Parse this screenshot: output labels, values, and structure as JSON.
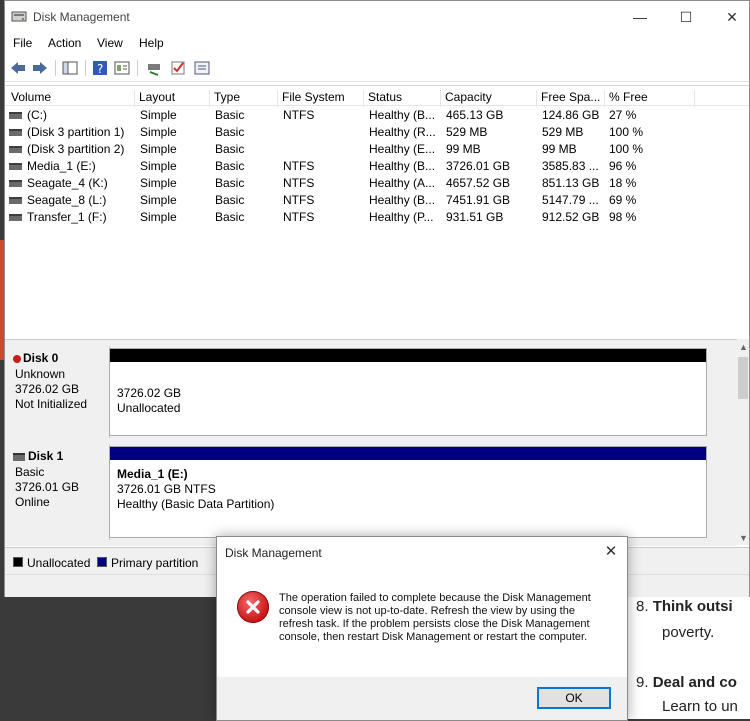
{
  "window": {
    "title": "Disk Management",
    "controls": {
      "minimize": "—",
      "maximize": "☐",
      "close": "✕"
    }
  },
  "menu": [
    "File",
    "Action",
    "View",
    "Help"
  ],
  "volumes": {
    "columns": [
      "Volume",
      "Layout",
      "Type",
      "File System",
      "Status",
      "Capacity",
      "Free Spa...",
      "% Free"
    ],
    "rows": [
      [
        "(C:)",
        "Simple",
        "Basic",
        "NTFS",
        "Healthy (B...",
        "465.13 GB",
        "124.86 GB",
        "27 %"
      ],
      [
        "(Disk 3 partition 1)",
        "Simple",
        "Basic",
        "",
        "Healthy (R...",
        "529 MB",
        "529 MB",
        "100 %"
      ],
      [
        "(Disk 3 partition 2)",
        "Simple",
        "Basic",
        "",
        "Healthy (E...",
        "99 MB",
        "99 MB",
        "100 %"
      ],
      [
        "Media_1 (E:)",
        "Simple",
        "Basic",
        "NTFS",
        "Healthy (B...",
        "3726.01 GB",
        "3585.83 ...",
        "96 %"
      ],
      [
        "Seagate_4 (K:)",
        "Simple",
        "Basic",
        "NTFS",
        "Healthy (A...",
        "4657.52 GB",
        "851.13 GB",
        "18 %"
      ],
      [
        "Seagate_8 (L:)",
        "Simple",
        "Basic",
        "NTFS",
        "Healthy (B...",
        "7451.91 GB",
        "5147.79 ...",
        "69 %"
      ],
      [
        "Transfer_1 (F:)",
        "Simple",
        "Basic",
        "NTFS",
        "Healthy (P...",
        "931.51 GB",
        "912.52 GB",
        "98 %"
      ]
    ]
  },
  "disks": [
    {
      "name": "Disk 0",
      "type": "Unknown",
      "size": "3726.02 GB",
      "state": "Not Initialized",
      "partition": {
        "line1": "3726.02 GB",
        "line2": "Unallocated",
        "line3": ""
      },
      "bar_color": "#000000"
    },
    {
      "name": "Disk 1",
      "type": "Basic",
      "size": "3726.01 GB",
      "state": "Online",
      "partition": {
        "line1": "Media_1  (E:)",
        "line2": "3726.01 GB NTFS",
        "line3": "Healthy (Basic Data Partition)"
      },
      "bar_color": "#000080"
    }
  ],
  "legend": [
    {
      "label": "Unallocated",
      "color": "#000000"
    },
    {
      "label": "Primary partition",
      "color": "#000080"
    }
  ],
  "dialog": {
    "title": "Disk Management",
    "close": "✕",
    "message": "The operation failed to complete because the Disk Management console view is not up-to-date.  Refresh the view by using the refresh task. If the problem persists close the Disk Management console, then restart Disk Management or restart the computer.",
    "ok_label": "OK",
    "icon": "error-icon"
  },
  "background_doc": {
    "item8_num": "8.",
    "item8_bold": "Think outsi",
    "item8_cont": "poverty.",
    "item9_num": "9.",
    "item9_bold": "Deal and co",
    "item9_cont": "Learn to un"
  }
}
